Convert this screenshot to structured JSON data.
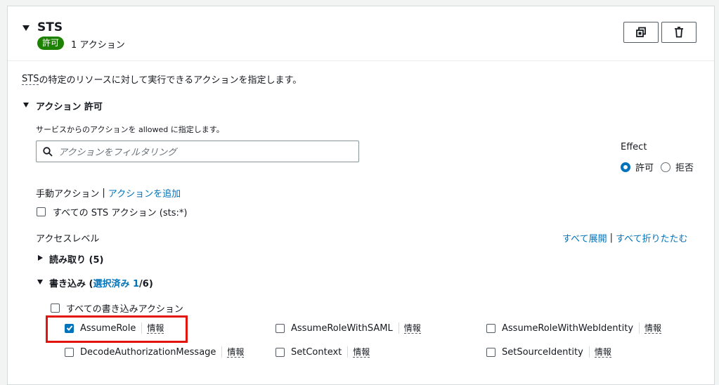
{
  "section": {
    "title": "STS",
    "badge": "許可",
    "action_count": "1 アクション"
  },
  "description": {
    "service": "STS",
    "text": " の特定のリソースに対して実行できるアクションを指定します。"
  },
  "actions": {
    "heading": "アクション 許可",
    "subtext_pre": "サービスからのアクションを ",
    "subtext_code": "allowed",
    "subtext_post": " に指定します。",
    "filter_placeholder": "アクションをフィルタリング"
  },
  "effect": {
    "label": "Effect",
    "allow": "許可",
    "deny": "拒否",
    "selected": "allow"
  },
  "manual": {
    "label": "手動アクション",
    "separator": "|",
    "add_link": "アクションを追加",
    "all_sts": "すべての STS アクション (sts:*)"
  },
  "access": {
    "label": "アクセスレベル",
    "expand_all": "すべて展開",
    "separator": "|",
    "collapse_all": "すべて折りたたむ"
  },
  "read": {
    "label": "読み取り (5)"
  },
  "write": {
    "label_pre": "書き込み (",
    "label_selected": "選択済み 1",
    "label_post": "/6)",
    "all_label": "すべての書き込みアクション",
    "items": [
      {
        "name": "AssumeRole",
        "info": "情報",
        "checked": true
      },
      {
        "name": "AssumeRoleWithSAML",
        "info": "情報",
        "checked": false
      },
      {
        "name": "AssumeRoleWithWebIdentity",
        "info": "情報",
        "checked": false
      },
      {
        "name": "DecodeAuthorizationMessage",
        "info": "情報",
        "checked": false
      },
      {
        "name": "SetContext",
        "info": "情報",
        "checked": false
      },
      {
        "name": "SetSourceIdentity",
        "info": "情報",
        "checked": false
      }
    ]
  },
  "colors": {
    "badge": "#1d8102",
    "link": "#0073bb",
    "highlight": "#e3140e"
  }
}
